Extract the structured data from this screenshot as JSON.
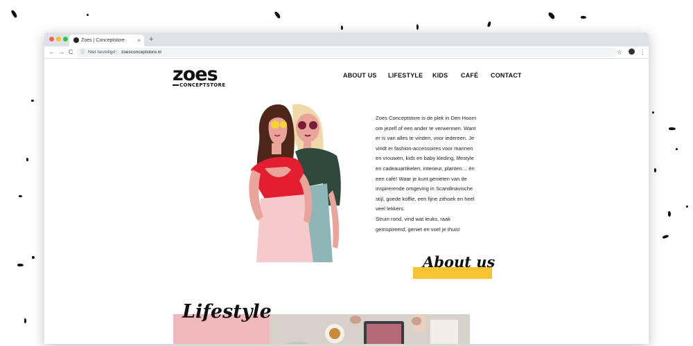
{
  "browser": {
    "tab_title": "Zoes | Conceptstore",
    "tab_close": "×",
    "new_tab": "+",
    "back": "←",
    "forward": "→",
    "reload": "C",
    "info_icon": "ⓘ",
    "security": "Niet beveiligd",
    "separator": "|",
    "url": "zoesconceptstore.nl",
    "star": "☆",
    "menu": "⋮"
  },
  "site": {
    "logo_word": "zoes",
    "logo_sub": "CONCEPTSTORE",
    "nav": [
      "ABOUT US",
      "LIFESTYLE",
      "KIDS",
      "CAFÉ",
      "CONTACT"
    ]
  },
  "about": {
    "paragraph": "Zoes Conceptstore is de plek in Den Hoorn om jezelf of een ander te verwennen. Want er is van alles te vinden, voor iedereen. Je vindt er fashion-accessoires voor mannen en vrouwen, kids en baby kleding, lifestyle en cadeauartikelen, interieur, planten… én een café! Waar je kunt genieten van de inspirerende omgeving in Scandinavische stijl, goede koffie, een fijne zithoek en heel veel lekkers.",
    "closing": "Struin rond, vind wat leuks, raak geïnspireerd, geniet en voel je thuis!",
    "heading": "About us"
  },
  "lifestyle": {
    "heading": "Lifestyle"
  },
  "colors": {
    "accent_yellow": "#f7c433",
    "accent_pink": "#f0b9bc",
    "shirt_red": "#e31e30",
    "shirt_green": "#2f4a3c"
  }
}
